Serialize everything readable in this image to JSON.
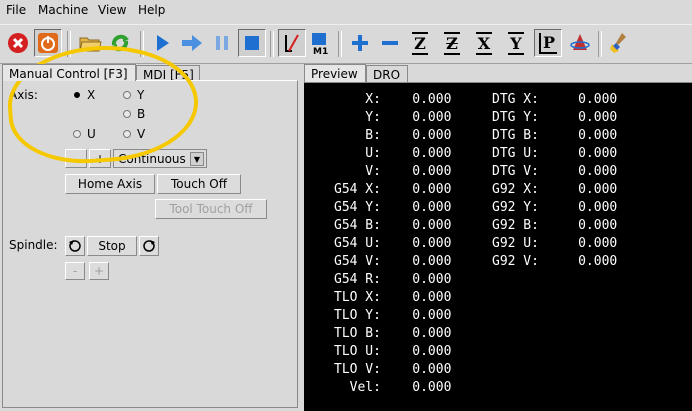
{
  "menu": [
    "File",
    "Machine",
    "View",
    "Help"
  ],
  "menu_underline": [
    "F",
    "M",
    "V",
    "H"
  ],
  "tabs_left": [
    "Manual Control [F3]",
    "MDI [F5]"
  ],
  "tabs_right": [
    "Preview",
    "DRO"
  ],
  "manual": {
    "axis_label": "Axis:",
    "axes": [
      "X",
      "Y",
      "B",
      "U",
      "V"
    ],
    "selected_axis": "X",
    "jog_minus": "-",
    "jog_plus": "+",
    "jog_mode": "Continuous",
    "home_axis": "Home Axis",
    "touch_off": "Touch Off",
    "tool_touch_off": "Tool Touch Off",
    "spindle_label": "Spindle:",
    "spindle_stop": "Stop",
    "speed_minus": "-",
    "speed_plus": "+"
  },
  "dro_left": [
    "    X:    0.000",
    "    Y:    0.000",
    "    B:    0.000",
    "    U:    0.000",
    "    V:    0.000",
    "G54 X:    0.000",
    "G54 Y:    0.000",
    "G54 B:    0.000",
    "G54 U:    0.000",
    "G54 V:    0.000",
    "G54 R:    0.000",
    "TLO X:    0.000",
    "TLO Y:    0.000",
    "TLO B:    0.000",
    "TLO U:    0.000",
    "TLO V:    0.000",
    "  Vel:    0.000"
  ],
  "dro_right": [
    "DTG X:     0.000",
    "DTG Y:     0.000",
    "DTG B:     0.000",
    "DTG U:     0.000",
    "DTG V:     0.000",
    "G92 X:     0.000",
    "G92 Y:     0.000",
    "G92 B:     0.000",
    "G92 U:     0.000",
    "G92 V:     0.000"
  ],
  "toolbar_icons": [
    "estop-icon",
    "power-icon",
    "open-folder-icon",
    "reload-icon",
    "run-icon",
    "step-icon",
    "pause-icon",
    "stop-icon",
    "block-delete-icon",
    "optional-stop-icon",
    "zoom-in-icon",
    "zoom-out-icon",
    "view-z-icon",
    "view-z2-icon",
    "view-x-icon",
    "view-y-icon",
    "view-p-icon",
    "rotate-view-icon",
    "clear-plot-icon"
  ],
  "toolbar_text": {
    "m1": "M1",
    "z": "Z",
    "z2": "Z",
    "x": "X",
    "y": "Y",
    "p": "P"
  },
  "colors": {
    "estop": "#d42020",
    "power_active": "#e06a1a",
    "run": "#1f6fd0",
    "highlight": "#f5c800",
    "dro_bg": "#000000",
    "dro_text": "#ffffff"
  }
}
